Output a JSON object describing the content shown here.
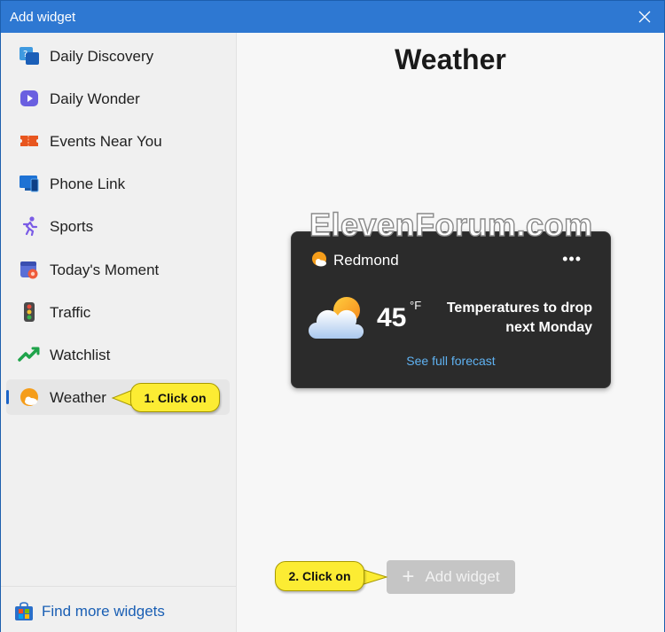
{
  "window": {
    "title": "Add widget"
  },
  "sidebar": {
    "items": [
      {
        "label": "Daily Discovery",
        "icon": "daily-discovery-icon"
      },
      {
        "label": "Daily Wonder",
        "icon": "daily-wonder-icon"
      },
      {
        "label": "Events Near You",
        "icon": "events-ticket-icon"
      },
      {
        "label": "Phone Link",
        "icon": "phone-link-icon"
      },
      {
        "label": "Sports",
        "icon": "sports-runner-icon"
      },
      {
        "label": "Today's Moment",
        "icon": "todays-moment-icon"
      },
      {
        "label": "Traffic",
        "icon": "traffic-light-icon"
      },
      {
        "label": "Watchlist",
        "icon": "watchlist-chart-icon"
      },
      {
        "label": "Weather",
        "icon": "weather-sun-icon",
        "selected": true
      }
    ],
    "find_more": "Find more widgets"
  },
  "main": {
    "heading": "Weather",
    "watermark": "ElevenForum.com",
    "card": {
      "location": "Redmond",
      "more": "•••",
      "temperature": "45",
      "unit": "°F",
      "description": "Temperatures to drop next Monday",
      "forecast_link": "See full forecast"
    },
    "add_button": {
      "plus": "+",
      "label": "Add widget"
    }
  },
  "callouts": {
    "step1": "1. Click on",
    "step2": "2. Click on"
  },
  "colors": {
    "titlebar": "#2e78d2",
    "accent": "#1b63c6",
    "callout": "#fcec33",
    "card": "#2b2b2b",
    "link": "#5fb2f2"
  }
}
